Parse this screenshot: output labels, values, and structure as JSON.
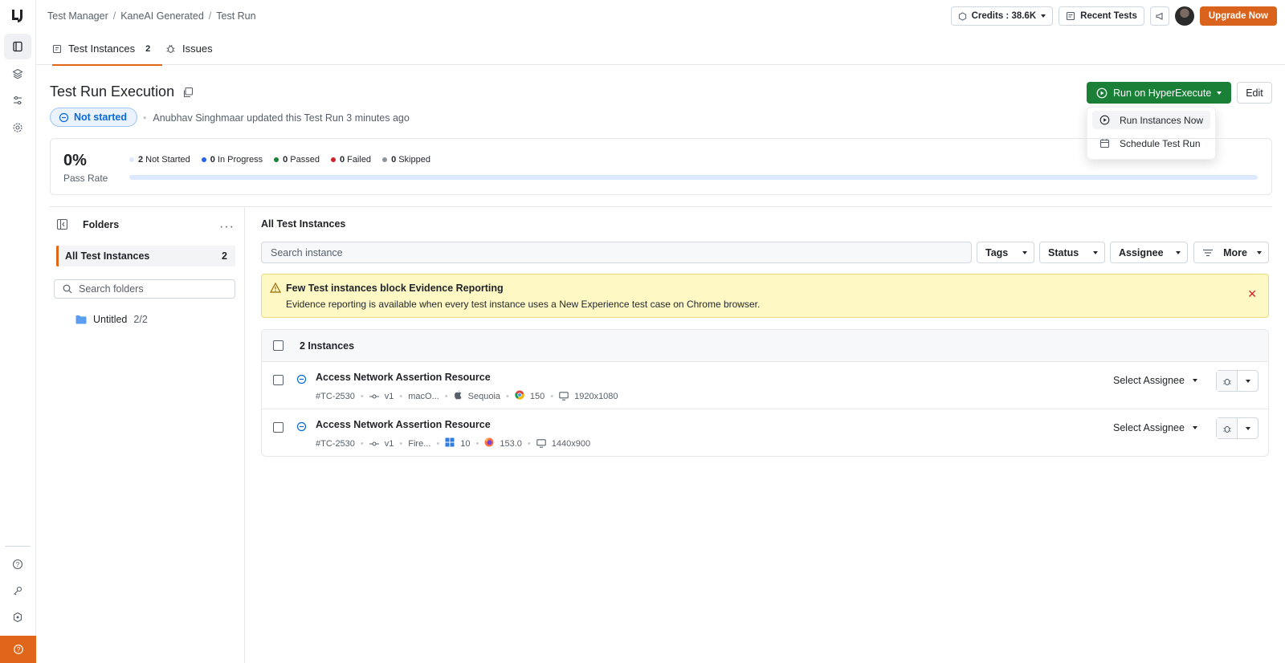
{
  "breadcrumb": [
    "Test Manager",
    "KaneAI Generated",
    "Test Run"
  ],
  "topbar": {
    "credits": "Credits : 38.6K",
    "recent_tests": "Recent Tests",
    "upgrade": "Upgrade Now"
  },
  "tabs": [
    {
      "label": "Test Instances",
      "count": "2"
    },
    {
      "label": "Issues"
    }
  ],
  "header": {
    "title": "Test Run Execution",
    "status": "Not started",
    "updated": "Anubhav Singhmaar updated this Test Run 3 minutes ago",
    "run_button": "Run on HyperExecute",
    "edit_button": "Edit"
  },
  "run_menu": [
    "Run Instances Now",
    "Schedule Test Run"
  ],
  "progress": {
    "percent": "0%",
    "label": "Pass Rate",
    "fill_fraction": 0,
    "legend": [
      {
        "count": "2",
        "label": "Not Started",
        "color": "#dbeafe"
      },
      {
        "count": "0",
        "label": "In Progress",
        "color": "#2563eb"
      },
      {
        "count": "0",
        "label": "Passed",
        "color": "#1a7f37"
      },
      {
        "count": "0",
        "label": "Failed",
        "color": "#cf222e"
      },
      {
        "count": "0",
        "label": "Skipped",
        "color": "#8c959f"
      }
    ]
  },
  "folders": {
    "title": "Folders",
    "all_label": "All Test Instances",
    "all_count": "2",
    "search_placeholder": "Search folders",
    "items": [
      {
        "name": "Untitled",
        "count": "2/2"
      }
    ]
  },
  "instances": {
    "title": "All Test Instances",
    "search_placeholder": "Search instance",
    "filters": [
      "Tags",
      "Status",
      "Assignee",
      "More"
    ],
    "banner": {
      "title": "Few Test instances block Evidence Reporting",
      "body": "Evidence reporting is available when every test instance uses a New Experience test case on Chrome browser."
    },
    "count_label": "2 Instances",
    "rows": [
      {
        "name": "Access Network Assertion Resource",
        "id": "#TC-2530",
        "version": "v1",
        "os": "macO...",
        "os_version": "Sequoia",
        "browser_version": "150",
        "resolution": "1920x1080",
        "assignee": "Select Assignee"
      },
      {
        "name": "Access Network Assertion Resource",
        "id": "#TC-2530",
        "version": "v1",
        "os": "Fire...",
        "os_version": "10",
        "browser_version": "153.0",
        "resolution": "1440x900",
        "assignee": "Select Assignee"
      }
    ]
  },
  "colors": {
    "accent": "#e0661a",
    "primary_green": "#1a7f37",
    "banner_bg": "#fdf8c4"
  }
}
